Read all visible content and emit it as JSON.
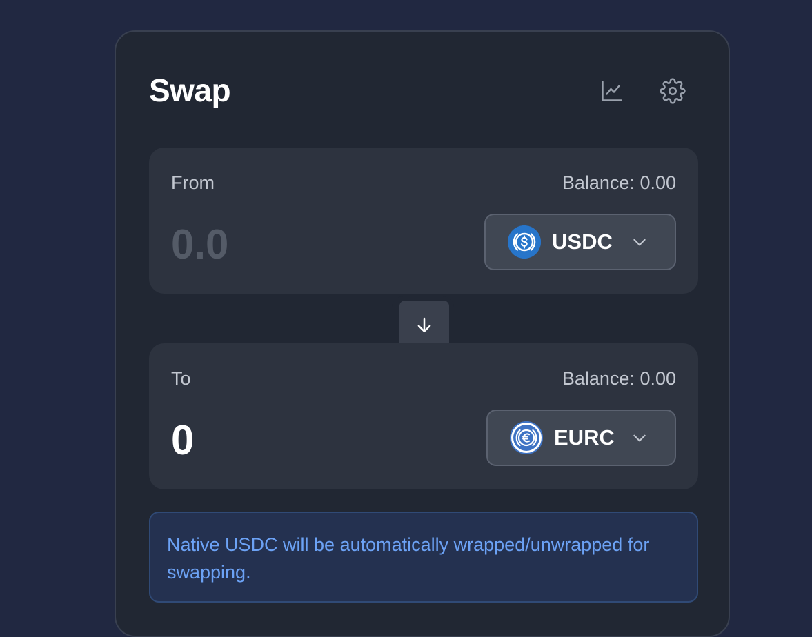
{
  "header": {
    "title": "Swap",
    "chart_icon": "line-chart-icon",
    "settings_icon": "gear-icon"
  },
  "from": {
    "label": "From",
    "balance": "Balance: 0.00",
    "amount_placeholder": "0.0",
    "token": {
      "symbol": "USDC",
      "icon": "usdc-logo-icon",
      "color": "#2775ca"
    }
  },
  "swap_direction_icon": "arrow-down-icon",
  "to": {
    "label": "To",
    "balance": "Balance: 0.00",
    "amount": "0",
    "token": {
      "symbol": "EURC",
      "icon": "eurc-logo-icon",
      "color": "#3e73c4"
    }
  },
  "notice": {
    "text": "Native USDC will be automatically wrapped/unwrapped for swapping."
  },
  "colors": {
    "page_bg": "#212841",
    "card_bg": "#212733",
    "panel_bg": "#2d333f",
    "notice_text": "#6ca2f5",
    "notice_bg": "#243150"
  }
}
